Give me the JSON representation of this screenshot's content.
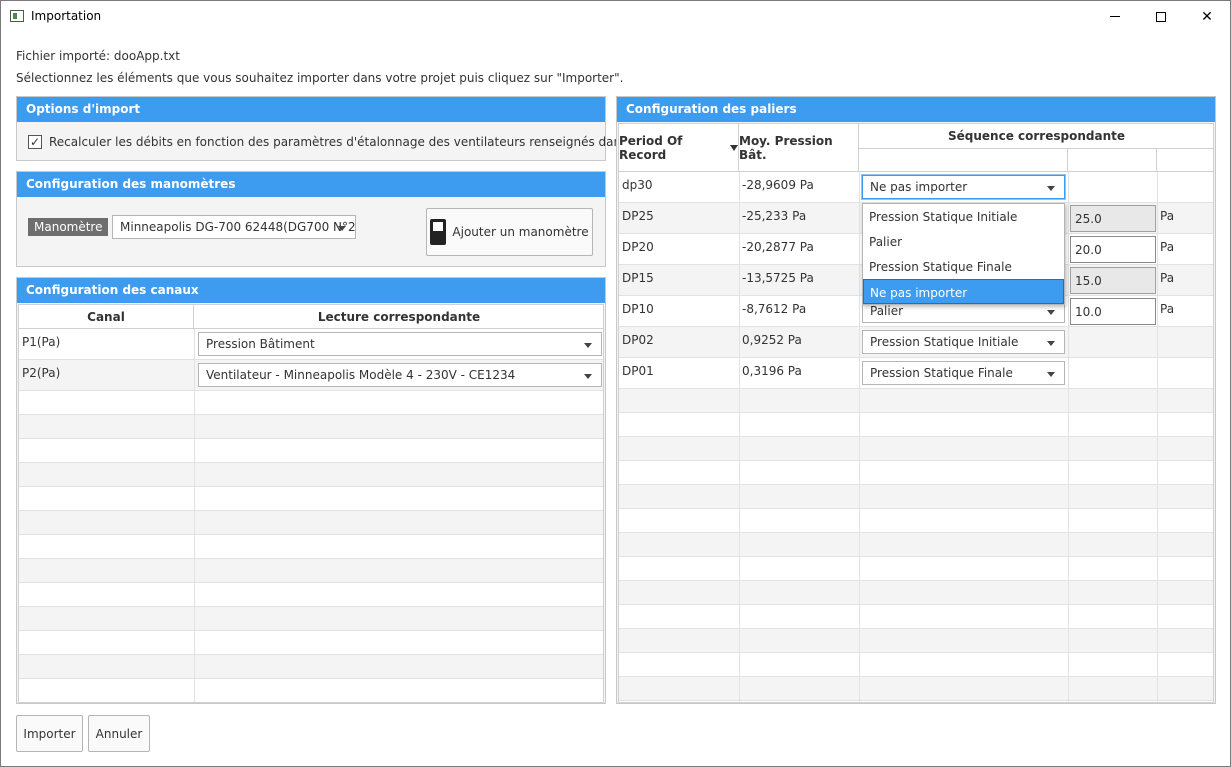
{
  "window": {
    "title": "Importation"
  },
  "info": {
    "file_line": "Fichier importé: dooApp.txt",
    "instructions": "Sélectionnez les éléments que vous souhaitez importer dans votre projet puis cliquez sur \"Importer\"."
  },
  "options": {
    "title": "Options d'import",
    "recalc_label": "Recalculer les débits en fonction des paramètres d'étalonnage des ventilateurs renseignés dans Infiltrea",
    "recalc_checked": "✓"
  },
  "manometres": {
    "title": "Configuration des manomètres",
    "tag": "Manomètre",
    "selected": "Minneapolis DG-700 62448(DG700 N°2)",
    "add_button": "Ajouter un manomètre"
  },
  "canaux": {
    "title": "Configuration des canaux",
    "col_canal": "Canal",
    "col_lecture": "Lecture correspondante",
    "rows": [
      {
        "canal": "P1(Pa)",
        "lecture": "Pression Bâtiment"
      },
      {
        "canal": "P2(Pa)",
        "lecture": "Ventilateur - Minneapolis Modèle 4 - 230V - CE1234"
      }
    ]
  },
  "paliers": {
    "title": "Configuration des paliers",
    "col_period": "Period Of Record",
    "col_pression": "Moy. Pression Bât.",
    "col_sequence": "Séquence correspondante",
    "rows": [
      {
        "period": "dp30",
        "pression": "-28,9609 Pa",
        "sequence": "Ne pas importer",
        "value": "",
        "unit": ""
      },
      {
        "period": "DP25",
        "pression": "-25,233 Pa",
        "sequence": "",
        "value": "25.0",
        "unit": "Pa"
      },
      {
        "period": "DP20",
        "pression": "-20,2877 Pa",
        "sequence": "",
        "value": "20.0",
        "unit": "Pa"
      },
      {
        "period": "DP15",
        "pression": "-13,5725 Pa",
        "sequence": "",
        "value": "15.0",
        "unit": "Pa"
      },
      {
        "period": "DP10",
        "pression": "-8,7612 Pa",
        "sequence": "Palier",
        "value": "10.0",
        "unit": "Pa"
      },
      {
        "period": "DP02",
        "pression": "0,9252 Pa",
        "sequence": "Pression Statique Initiale",
        "value": "",
        "unit": ""
      },
      {
        "period": "DP01",
        "pression": "0,3196 Pa",
        "sequence": "Pression Statique Finale",
        "value": "",
        "unit": ""
      }
    ],
    "dropdown_options": [
      "Pression Statique Initiale",
      "Palier",
      "Pression Statique Finale",
      "Ne pas importer"
    ]
  },
  "footer": {
    "import_button": "Importer",
    "cancel_button": "Annuler"
  }
}
